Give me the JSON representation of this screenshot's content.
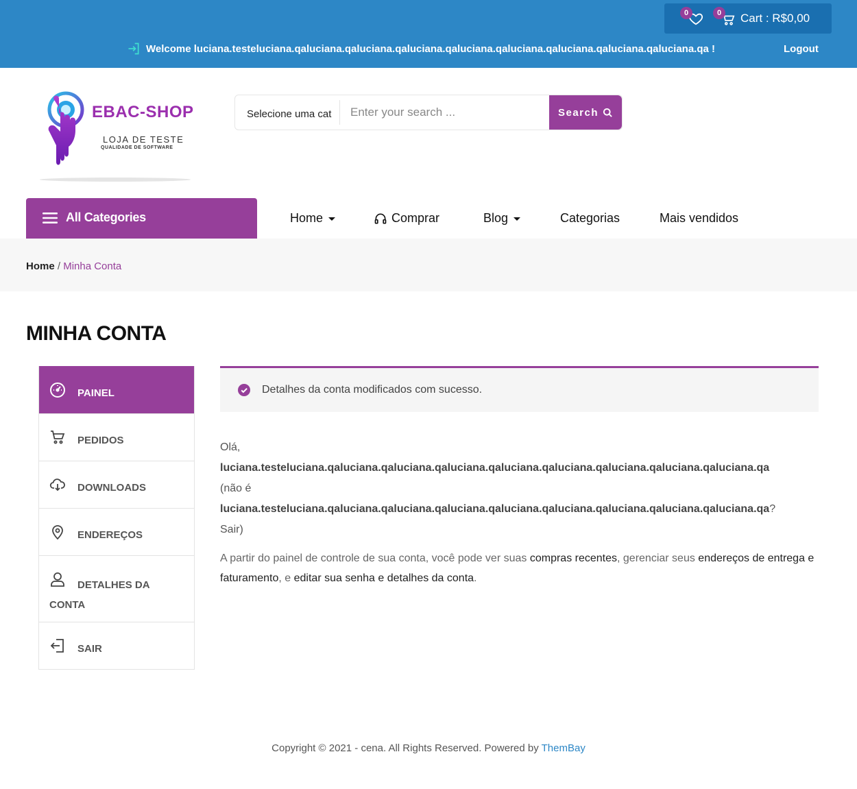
{
  "topbar": {
    "wishlist_count": "0",
    "cart_count": "0",
    "cart_label": "Cart : R$0,00",
    "welcome": "Welcome luciana.testeluciana.qaluciana.qaluciana.qaluciana.qaluciana.qaluciana.qaluciana.qaluciana.qaluciana.qa !",
    "logout": "Logout"
  },
  "logo": {
    "title": "EBAC-SHOP",
    "subtitle": "LOJA DE TESTE",
    "tagline": "QUALIDADE DE SOFTWARE"
  },
  "search": {
    "category": "Selecione uma cat",
    "placeholder": "Enter your search ...",
    "button": "Search"
  },
  "nav": {
    "all_categories": "All Categories",
    "items": [
      "Home",
      "Comprar",
      "Blog",
      "Categorias",
      "Mais vendidos"
    ]
  },
  "breadcrumb": {
    "home": "Home",
    "separator": "/",
    "current": "Minha Conta"
  },
  "page_title": "MINHA CONTA",
  "sidebar": {
    "items": [
      "Painel",
      "Pedidos",
      "Downloads",
      "Endereços",
      "Detalhes da conta",
      "Sair"
    ],
    "active": "Painel"
  },
  "notice": "Detalhes da conta modificados com sucesso.",
  "greeting": {
    "hello": "Olá,",
    "username": "luciana.testeluciana.qaluciana.qaluciana.qaluciana.qaluciana.qaluciana.qaluciana.qaluciana.qaluciana.qa",
    "not_you": "(não é",
    "question": "?",
    "logout": "Sair",
    "close": ")"
  },
  "info": {
    "part1": "A partir do painel de controle de sua conta, você pode ver suas ",
    "link1": "compras recentes",
    "part2": ", gerenciar seus ",
    "link2": "endereços de entrega e faturamento",
    "part3": ", e ",
    "link3": "editar sua senha e detalhes da conta",
    "part4": "."
  },
  "footer": {
    "text": "Copyright © 2021 - cena. All Rights Reserved. Powered by ",
    "link": "ThemBay"
  },
  "colors": {
    "topbar": "#2d87c6",
    "accent": "#963f9a"
  }
}
